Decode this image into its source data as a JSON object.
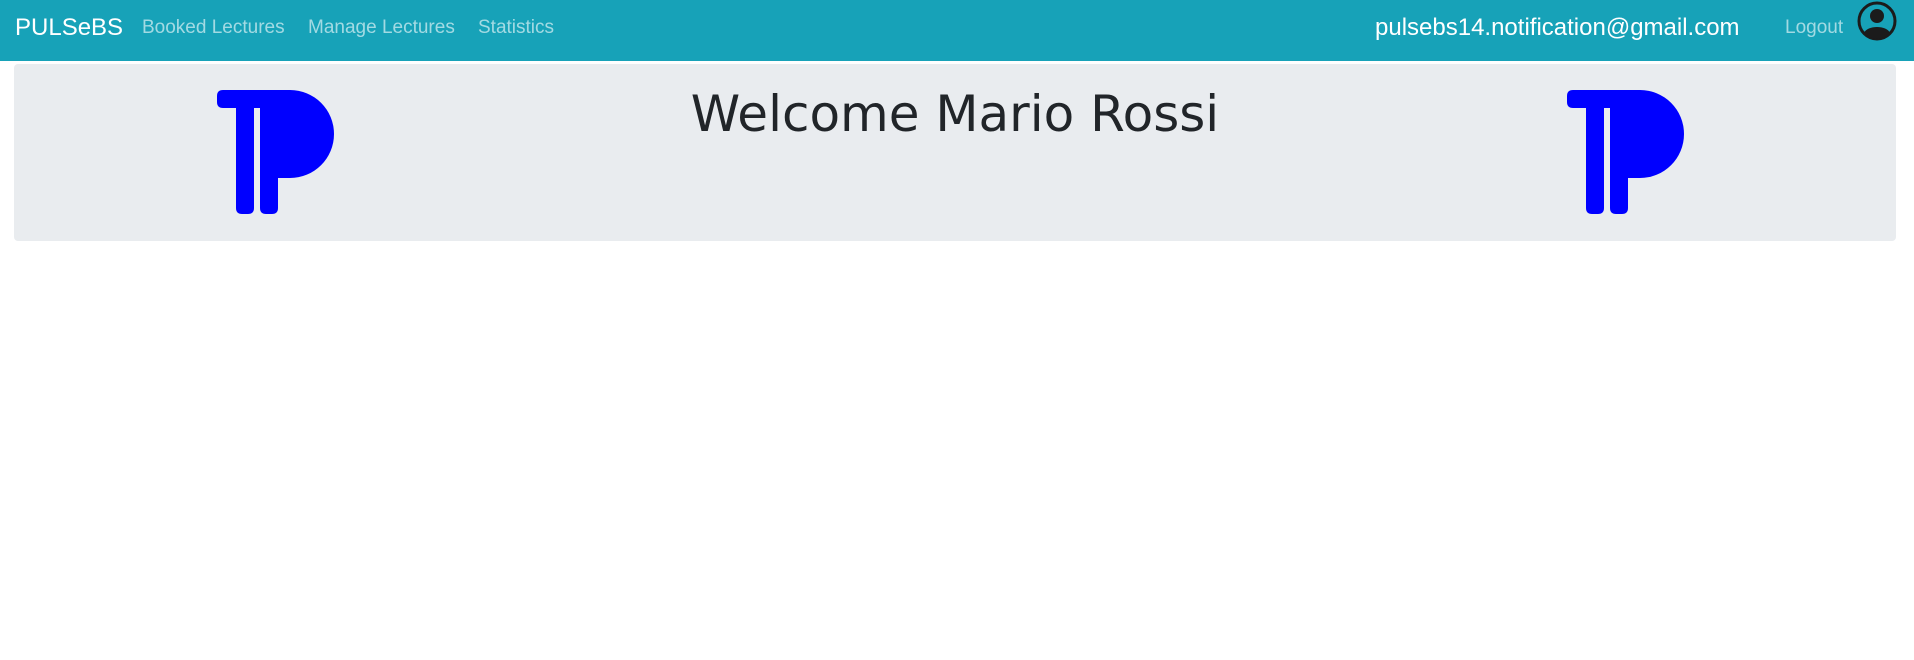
{
  "navbar": {
    "brand": "PULSeBS",
    "links": [
      {
        "label": "Booked Lectures"
      },
      {
        "label": "Manage Lectures"
      },
      {
        "label": "Statistics"
      }
    ],
    "user_email": "pulsebs14.notification@gmail.com",
    "logout_label": "Logout",
    "avatar_icon": "user-circle-icon",
    "background_color": "#17a2b8"
  },
  "jumbotron": {
    "welcome_text": "Welcome Mario Rossi",
    "logo_icon": "pulsebs-logo-icon",
    "logo_color": "#0000ff",
    "background_color": "#e9ecef"
  }
}
